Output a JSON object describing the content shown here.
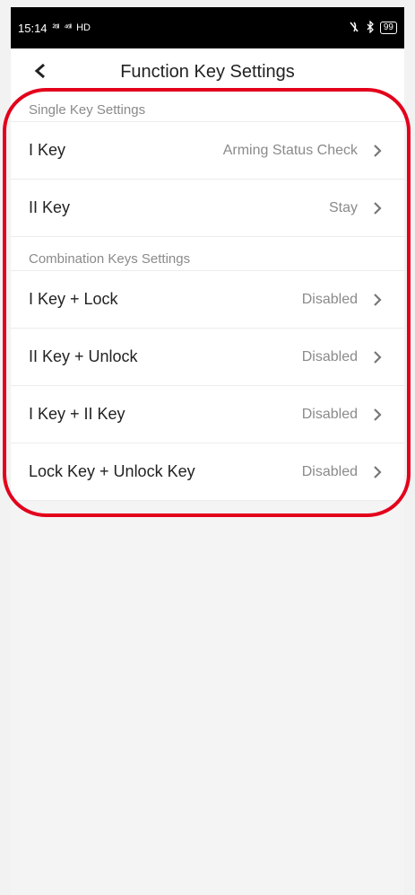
{
  "status": {
    "time": "15:14",
    "sig1": "²⁶ᴵᴵ",
    "sig2": "⁴⁶ᴵᴵ",
    "hd": "HD",
    "battery": "99"
  },
  "header": {
    "title": "Function Key Settings"
  },
  "sections": [
    {
      "header": "Single Key Settings",
      "rows": [
        {
          "label": "I Key",
          "value": "Arming Status Check"
        },
        {
          "label": "II Key",
          "value": "Stay"
        }
      ]
    },
    {
      "header": "Combination Keys Settings",
      "rows": [
        {
          "label": "I Key + Lock",
          "value": "Disabled"
        },
        {
          "label": "II Key + Unlock",
          "value": "Disabled"
        },
        {
          "label": "I Key + II Key",
          "value": "Disabled"
        },
        {
          "label": "Lock Key + Unlock Key",
          "value": "Disabled"
        }
      ]
    }
  ],
  "colors": {
    "accent": "#e3001b",
    "text": "#222222",
    "muted": "#8a8a8a"
  }
}
